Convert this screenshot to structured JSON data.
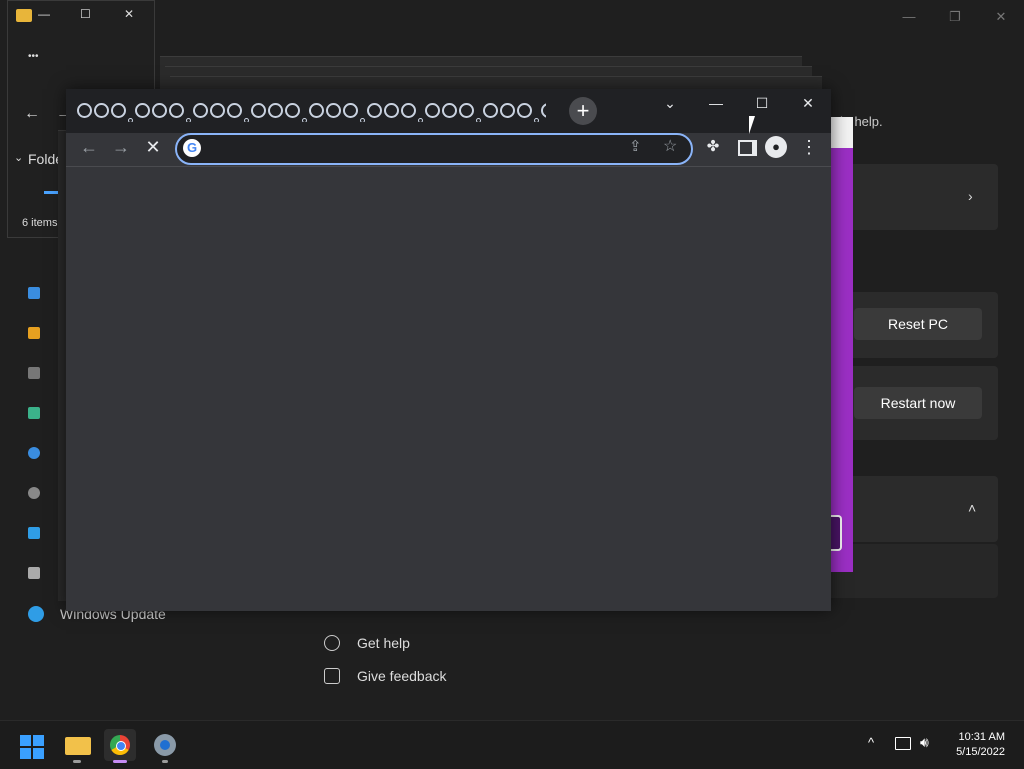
{
  "settings": {
    "help_text": "ht help.",
    "reset_button": "Reset PC",
    "restart_button": "Restart now",
    "sidebar_last_item": "Windows Update",
    "get_help": "Get help",
    "give_feedback": "Give feedback",
    "window_controls": {
      "minimize": "—",
      "maximize": "❐",
      "close": "✕"
    }
  },
  "explorer": {
    "more": "•••",
    "breadcrumb": "Folde",
    "status": "6 items",
    "controls": {
      "minimize": "—",
      "maximize": "☐",
      "close": "✕"
    }
  },
  "chrome": {
    "window_controls": {
      "dropdown": "⌄",
      "minimize": "—",
      "maximize": "☐",
      "close": "✕"
    },
    "new_tab": "+",
    "omnibox": {
      "value": "",
      "placeholder": ""
    },
    "google_glyph": "G",
    "tab_count": 35
  },
  "taskbar": {
    "clock_time": "10:31 AM",
    "clock_date": "5/15/2022",
    "tray_chevron": "^"
  },
  "colors": {
    "accent_purple": "#9b2fc4",
    "chrome_focus": "#8ab4f8"
  }
}
